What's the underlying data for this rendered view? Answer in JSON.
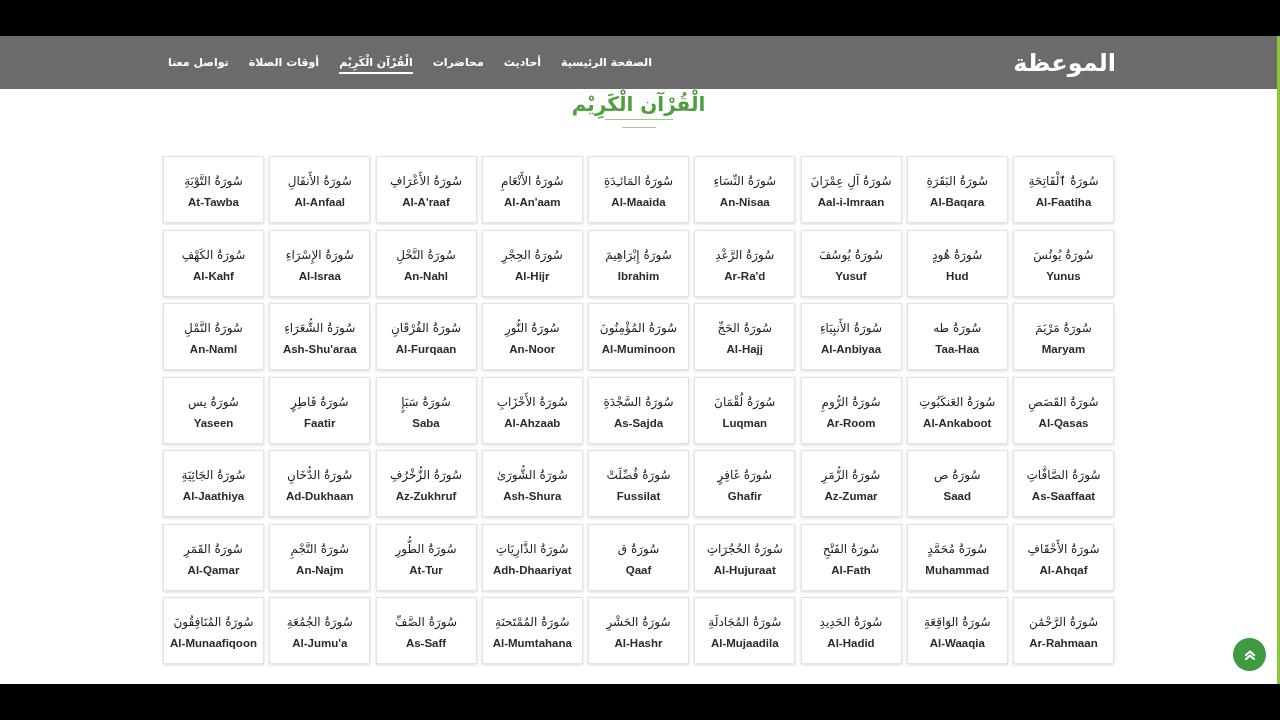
{
  "logo": {
    "text": "الموعظة"
  },
  "nav": {
    "links": [
      {
        "label": "الصفحة الرئيسية",
        "selected": false
      },
      {
        "label": "أحاديث",
        "selected": false
      },
      {
        "label": "محاضرات",
        "selected": false
      },
      {
        "label": "الْقُرْآن الْكَرِيْم",
        "selected": true
      },
      {
        "label": "أوقات الصلاة",
        "selected": false
      },
      {
        "label": "تواصل معنا",
        "selected": false
      }
    ]
  },
  "page_title": "الْقُرْآن الْكَرِيْم",
  "surahs": [
    {
      "arabic": "سُورَةُ ٱلْفَاتِحَةِ",
      "latin": "Al-Faatiha"
    },
    {
      "arabic": "سُورَةُ البَقَرَةِ",
      "latin": "Al-Baqara"
    },
    {
      "arabic": "سُورَةُ آلِ عِمْرَانَ",
      "latin": "Aal-i-Imraan"
    },
    {
      "arabic": "سُورَةُ النِّسَاءِ",
      "latin": "An-Nisaa"
    },
    {
      "arabic": "سُورَةُ المَائـِدَةِ",
      "latin": "Al-Maaida"
    },
    {
      "arabic": "سُورَةُ الأَنْعَامِ",
      "latin": "Al-An'aam"
    },
    {
      "arabic": "سُورَةُ الأَعْرَافِ",
      "latin": "Al-A'raaf"
    },
    {
      "arabic": "سُورَةُ الأَنفَالِ",
      "latin": "Al-Anfaal"
    },
    {
      "arabic": "سُورَةُ التَّوْبَةِ",
      "latin": "At-Tawba"
    },
    {
      "arabic": "سُورَةُ يُونُسَ",
      "latin": "Yunus"
    },
    {
      "arabic": "سُورَةُ هُودٍ",
      "latin": "Hud"
    },
    {
      "arabic": "سُورَةُ يُوسُفَ",
      "latin": "Yusuf"
    },
    {
      "arabic": "سُورَةُ الرَّعْدِ",
      "latin": "Ar-Ra'd"
    },
    {
      "arabic": "سُورَةُ إِبْرَاهِيمَ",
      "latin": "Ibrahim"
    },
    {
      "arabic": "سُورَةُ الحِجْرِ",
      "latin": "Al-Hijr"
    },
    {
      "arabic": "سُورَةُ النَّحْلِ",
      "latin": "An-Nahl"
    },
    {
      "arabic": "سُورَةُ الإِسْرَاءِ",
      "latin": "Al-Israa"
    },
    {
      "arabic": "سُورَةُ الكَهْفِ",
      "latin": "Al-Kahf"
    },
    {
      "arabic": "سُورَةُ مَرْيَمَ",
      "latin": "Maryam"
    },
    {
      "arabic": "سُورَةُ طه",
      "latin": "Taa-Haa"
    },
    {
      "arabic": "سُورَةُ الأَنبِيَاءِ",
      "latin": "Al-Anbiyaa"
    },
    {
      "arabic": "سُورَةُ الحَجِّ",
      "latin": "Al-Hajj"
    },
    {
      "arabic": "سُورَةُ المُؤْمِنُونَ",
      "latin": "Al-Muminoon"
    },
    {
      "arabic": "سُورَةُ النُّورِ",
      "latin": "An-Noor"
    },
    {
      "arabic": "سُورَةُ الفُرْقَانِ",
      "latin": "Al-Furqaan"
    },
    {
      "arabic": "سُورَةُ الشُّعَرَاءِ",
      "latin": "Ash-Shu'araa"
    },
    {
      "arabic": "سُورَةُ النَّمْلِ",
      "latin": "An-Naml"
    },
    {
      "arabic": "سُورَةُ القَصَصِ",
      "latin": "Al-Qasas"
    },
    {
      "arabic": "سُورَةُ العَنكَبُوتِ",
      "latin": "Al-Ankaboot"
    },
    {
      "arabic": "سُورَةُ الرُّومِ",
      "latin": "Ar-Room"
    },
    {
      "arabic": "سُورَةُ لُقْمَانَ",
      "latin": "Luqman"
    },
    {
      "arabic": "سُورَةُ السَّجْدَةِ",
      "latin": "As-Sajda"
    },
    {
      "arabic": "سُورَةُ الأَحْزَابِ",
      "latin": "Al-Ahzaab"
    },
    {
      "arabic": "سُورَةُ سَبَإٍ",
      "latin": "Saba"
    },
    {
      "arabic": "سُورَةُ فَاطِرٍ",
      "latin": "Faatir"
    },
    {
      "arabic": "سُورَةُ يس",
      "latin": "Yaseen"
    },
    {
      "arabic": "سُورَةُ الصَّافَّاتِ",
      "latin": "As-Saaffaat"
    },
    {
      "arabic": "سُورَةُ ص",
      "latin": "Saad"
    },
    {
      "arabic": "سُورَةُ الزُّمَرِ",
      "latin": "Az-Zumar"
    },
    {
      "arabic": "سُورَةُ غَافِرٍ",
      "latin": "Ghafir"
    },
    {
      "arabic": "سُورَةُ فُصِّلَتْ",
      "latin": "Fussilat"
    },
    {
      "arabic": "سُورَةُ الشُّورَىٰ",
      "latin": "Ash-Shura"
    },
    {
      "arabic": "سُورَةُ الزُّخْرُفِ",
      "latin": "Az-Zukhruf"
    },
    {
      "arabic": "سُورَةُ الدُّخَانِ",
      "latin": "Ad-Dukhaan"
    },
    {
      "arabic": "سُورَةُ الجَاثِيَةِ",
      "latin": "Al-Jaathiya"
    },
    {
      "arabic": "سُورَةُ الأَحْقَافِ",
      "latin": "Al-Ahqaf"
    },
    {
      "arabic": "سُورَةُ مُحَمَّدٍ",
      "latin": "Muhammad"
    },
    {
      "arabic": "سُورَةُ الفَتْحِ",
      "latin": "Al-Fath"
    },
    {
      "arabic": "سُورَةُ الحُجُرَاتِ",
      "latin": "Al-Hujuraat"
    },
    {
      "arabic": "سُورَةُ ق",
      "latin": "Qaaf"
    },
    {
      "arabic": "سُورَةُ الذَّارِيَاتِ",
      "latin": "Adh-Dhaariyat"
    },
    {
      "arabic": "سُورَةُ الطُّورِ",
      "latin": "At-Tur"
    },
    {
      "arabic": "سُورَةُ النَّجْمِ",
      "latin": "An-Najm"
    },
    {
      "arabic": "سُورَةُ القَمَرِ",
      "latin": "Al-Qamar"
    },
    {
      "arabic": "سُورَةُ الرَّحْمَٰن",
      "latin": "Ar-Rahmaan"
    },
    {
      "arabic": "سُورَةُ الوَاقِعَةِ",
      "latin": "Al-Waaqia"
    },
    {
      "arabic": "سُورَةُ الحَدِيدِ",
      "latin": "Al-Hadid"
    },
    {
      "arabic": "سُورَةُ المُجَادلَةِ",
      "latin": "Al-Mujaadila"
    },
    {
      "arabic": "سُورَةُ الحَشْرِ",
      "latin": "Al-Hashr"
    },
    {
      "arabic": "سُورَةُ المُمْتَحنَةِ",
      "latin": "Al-Mumtahana"
    },
    {
      "arabic": "سُورَةُ الصَّفِّ",
      "latin": "As-Saff"
    },
    {
      "arabic": "سُورَةُ الجُمُعَةِ",
      "latin": "Al-Jumu'a"
    },
    {
      "arabic": "سُورَةُ المُنَافِقُونَ",
      "latin": "Al-Munaafiqoon"
    }
  ]
}
